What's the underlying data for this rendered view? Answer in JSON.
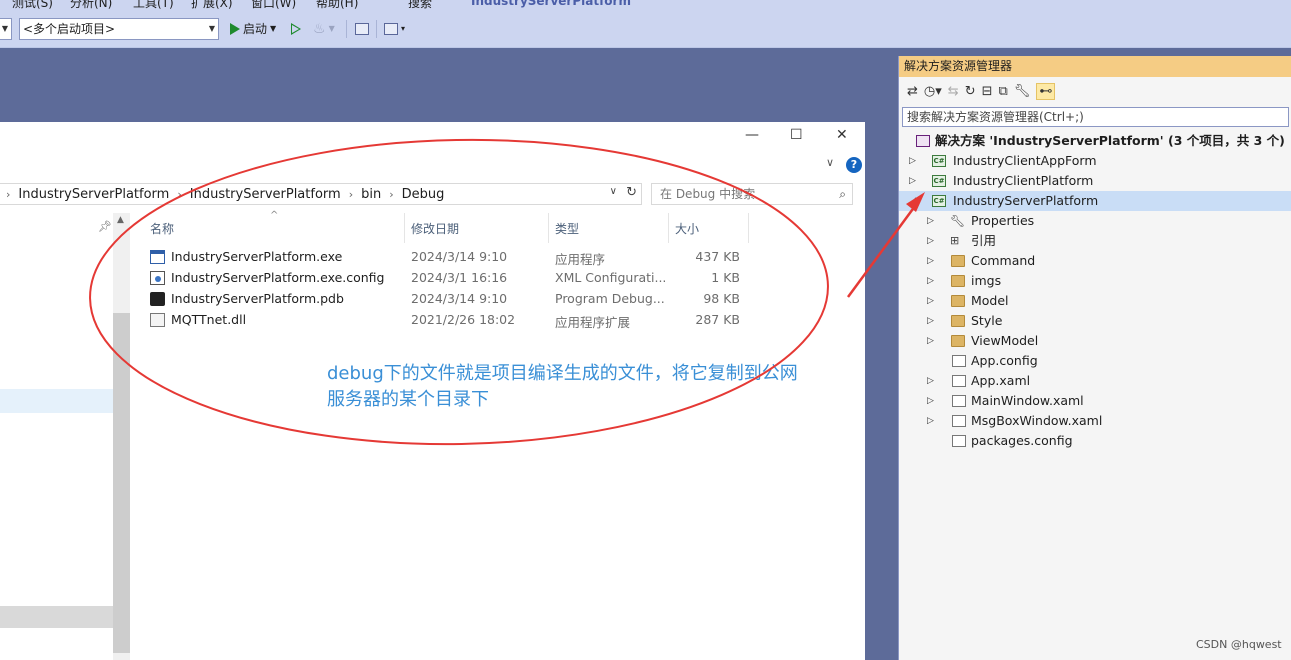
{
  "menu": {
    "items": [
      "测试(S)",
      "分析(N)",
      "工具(T)",
      "扩展(X)",
      "窗口(W)",
      "帮助(H)",
      "搜索"
    ],
    "app_title": "IndustryServerPlatform"
  },
  "toolbar": {
    "startup_combo": "<多个启动项目>",
    "start_label": "启动"
  },
  "explorer": {
    "breadcrumbs": [
      "IndustryServerPlatform",
      "IndustryServerPlatform",
      "bin",
      "Debug"
    ],
    "search_placeholder": "在 Debug 中搜索",
    "columns": {
      "name": "名称",
      "date": "修改日期",
      "type": "类型",
      "size": "大小"
    },
    "files": [
      {
        "name": "IndustryServerPlatform.exe",
        "date": "2024/3/14 9:10",
        "type": "应用程序",
        "size": "437 KB",
        "icon": "exe-icon"
      },
      {
        "name": "IndustryServerPlatform.exe.config",
        "date": "2024/3/1 16:16",
        "type": "XML Configurati...",
        "size": "1 KB",
        "icon": "config-file-icon"
      },
      {
        "name": "IndustryServerPlatform.pdb",
        "date": "2024/3/14 9:10",
        "type": "Program Debug...",
        "size": "98 KB",
        "icon": "pdb-file-icon"
      },
      {
        "name": "MQTTnet.dll",
        "date": "2021/2/26 18:02",
        "type": "应用程序扩展",
        "size": "287 KB",
        "icon": "dll-file-icon"
      }
    ],
    "help_glyph": "?"
  },
  "annotation": {
    "line1": "debug下的文件就是项目编译生成的文件，将它复制到公网",
    "line2": "服务器的某个目录下",
    "color": "#3a8fd6",
    "ellipse_color": "#e53935"
  },
  "solution_explorer": {
    "title": "解决方案资源管理器",
    "search_placeholder": "搜索解决方案资源管理器(Ctrl+;)",
    "solution_label": "解决方案 'IndustryServerPlatform' (3 个项目，共 3 个)",
    "projects": [
      "IndustryClientAppForm",
      "IndustryClientPlatform",
      "IndustryServerPlatform"
    ],
    "cs_badge": "C#",
    "items": [
      {
        "label": "Properties",
        "icon": "wrench-icon",
        "expandable": true
      },
      {
        "label": "引用",
        "icon": "references-icon",
        "expandable": true
      },
      {
        "label": "Command",
        "icon": "folder-icon",
        "expandable": true
      },
      {
        "label": "imgs",
        "icon": "folder-icon",
        "expandable": true
      },
      {
        "label": "Model",
        "icon": "folder-icon",
        "expandable": true
      },
      {
        "label": "Style",
        "icon": "folder-icon",
        "expandable": true
      },
      {
        "label": "ViewModel",
        "icon": "folder-icon",
        "expandable": true
      },
      {
        "label": "App.config",
        "icon": "config-file-icon",
        "expandable": false
      },
      {
        "label": "App.xaml",
        "icon": "xaml-file-icon",
        "expandable": true
      },
      {
        "label": "MainWindow.xaml",
        "icon": "xaml-file-icon",
        "expandable": true
      },
      {
        "label": "MsgBoxWindow.xaml",
        "icon": "xaml-file-icon",
        "expandable": true
      },
      {
        "label": "packages.config",
        "icon": "config-file-icon",
        "expandable": false
      }
    ]
  },
  "watermark": "CSDN @hqwest"
}
